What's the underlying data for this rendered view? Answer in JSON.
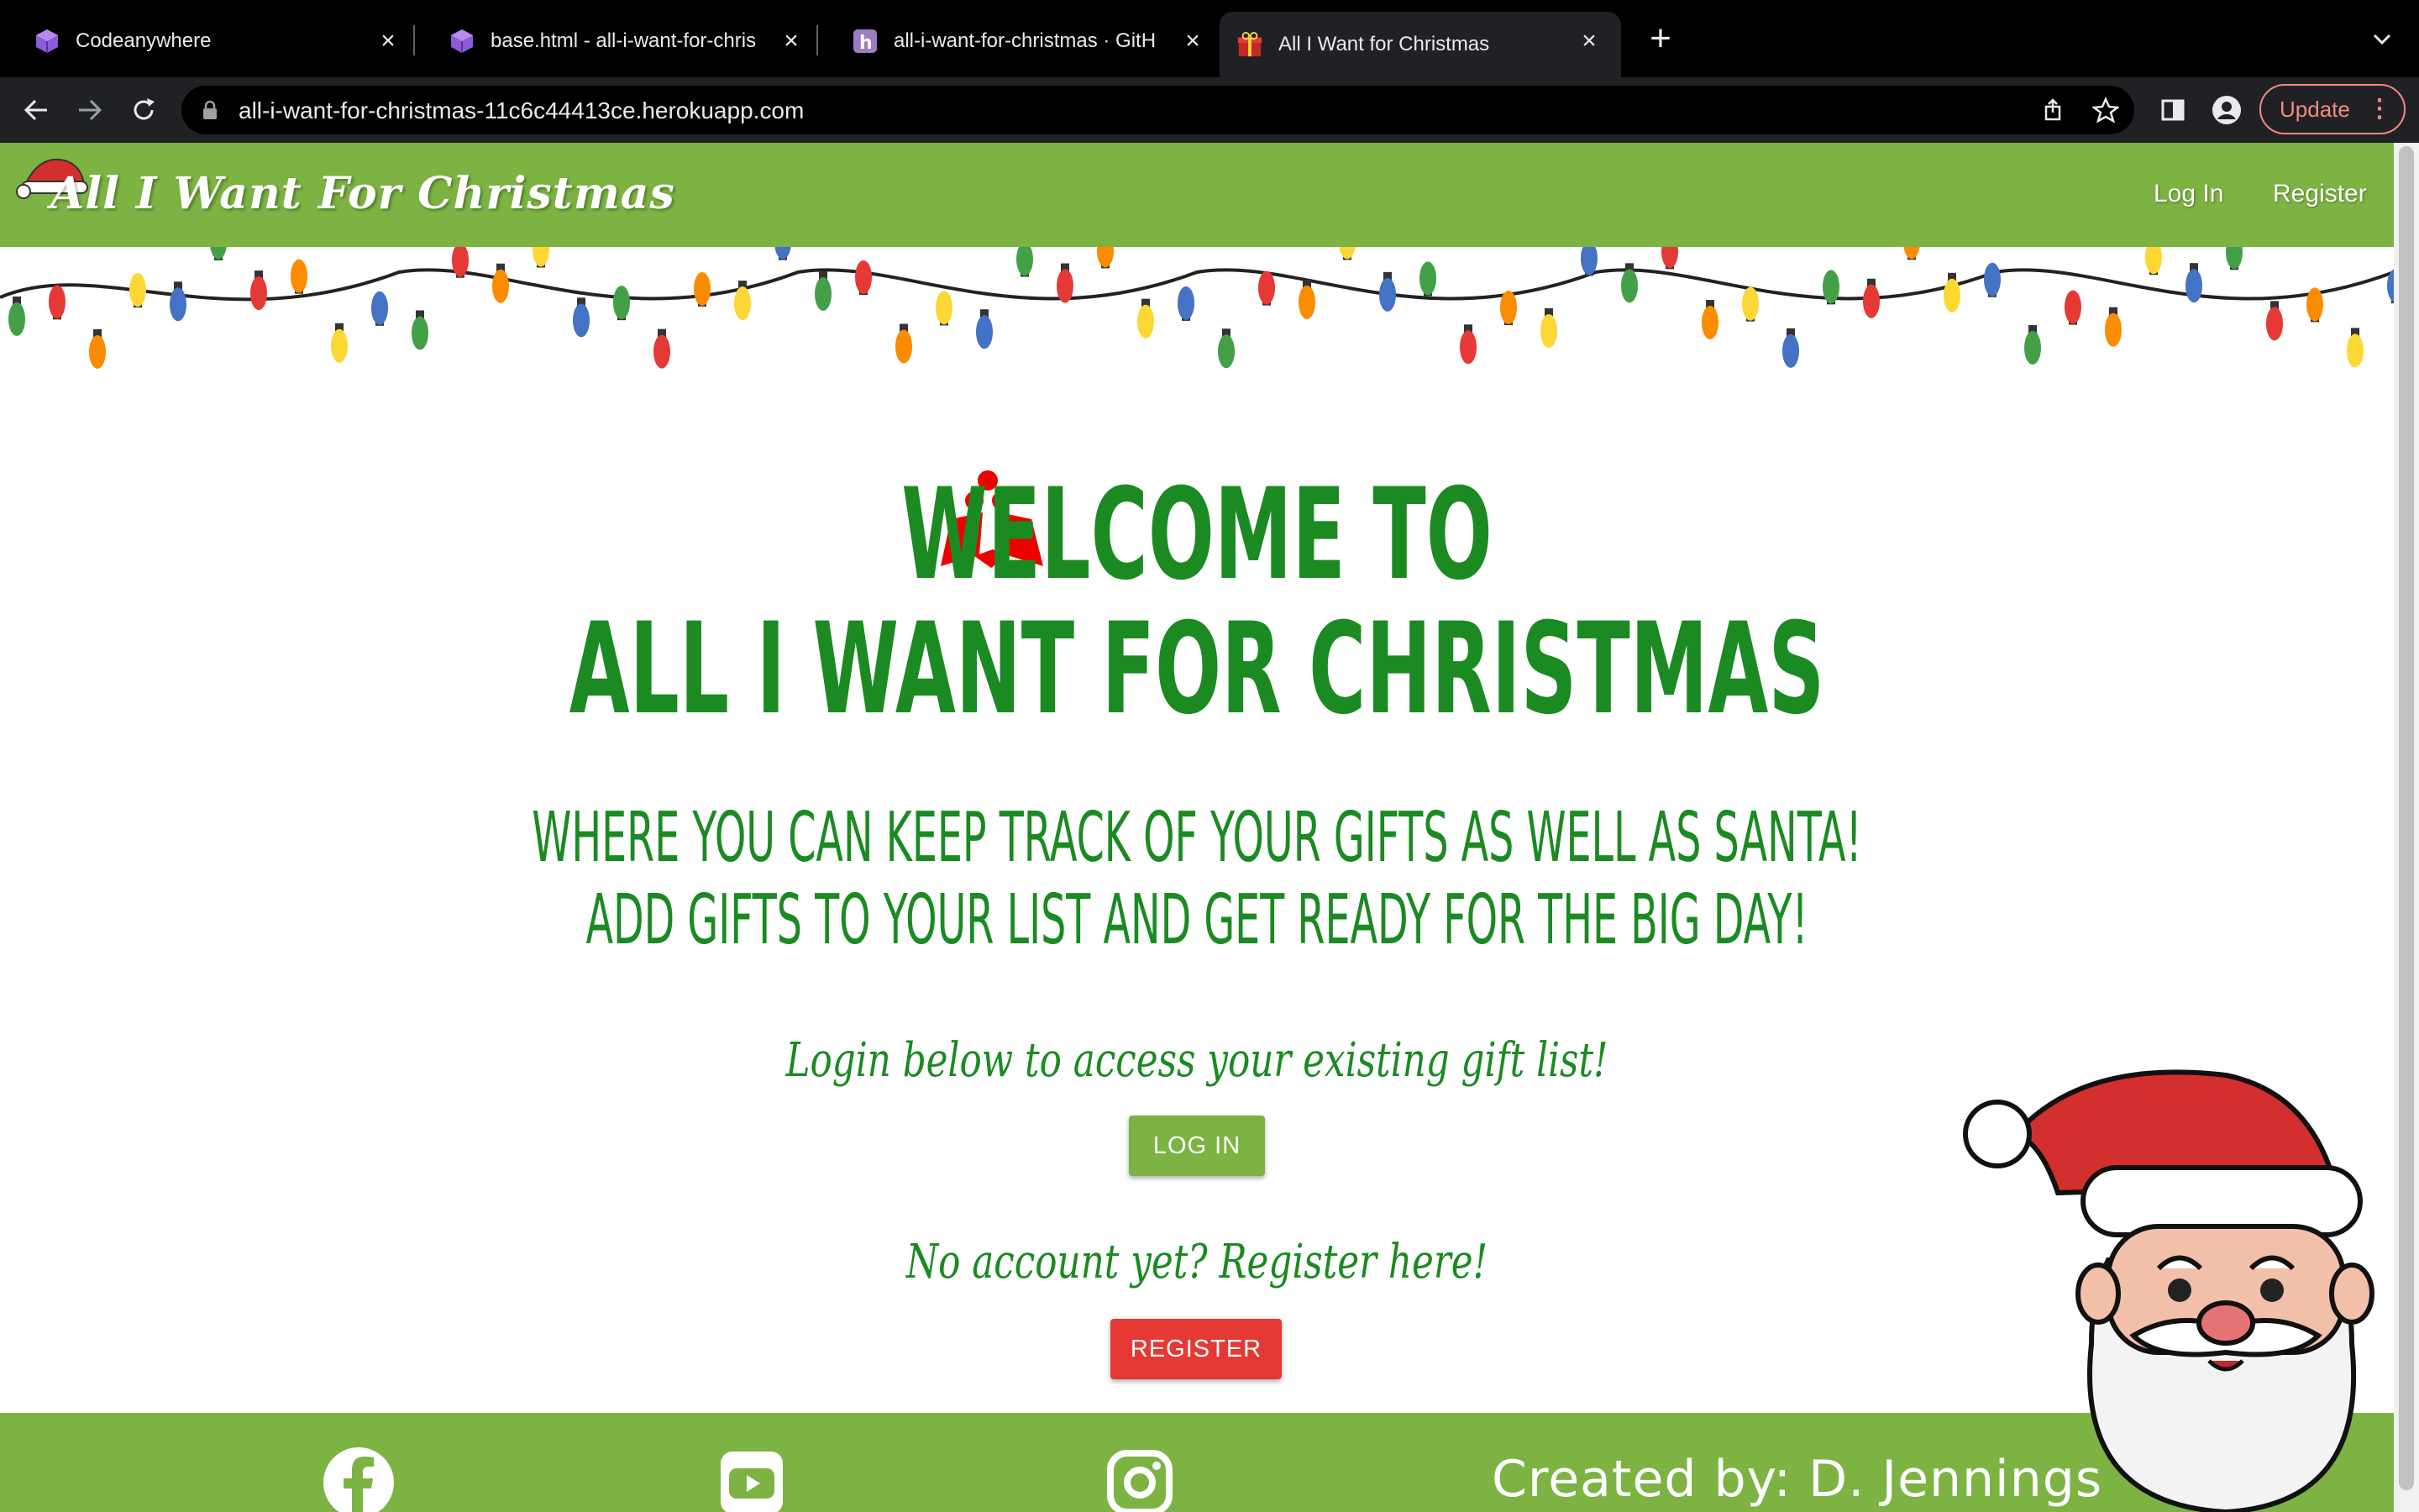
{
  "browser": {
    "tabs": [
      {
        "title": "Codeanywhere",
        "favicon": "codeanywhere-cube-icon",
        "active": false
      },
      {
        "title": "base.html - all-i-want-for-chris",
        "favicon": "codeanywhere-cube-icon",
        "active": false
      },
      {
        "title": "all-i-want-for-christmas · GitH",
        "favicon": "heroku-icon",
        "active": false
      },
      {
        "title": "All I Want for Christmas",
        "favicon": "gift-icon",
        "active": true
      }
    ],
    "url": "all-i-want-for-christmas-11c6c44413ce.herokuapp.com",
    "update_label": "Update"
  },
  "site": {
    "brand": "All I Want For Christmas",
    "nav": {
      "login": "Log In",
      "register": "Register"
    },
    "colors": {
      "primary_green": "#7cb342",
      "text_green": "#1b8a22",
      "register_red": "#e53935"
    }
  },
  "main": {
    "title_line1": "Welcome to",
    "title_line2": "All I Want For Christmas",
    "subtitle_line1": "Where you can keep track of your gifts as well as Santa!",
    "subtitle_line2": "Add gifts to your list and get ready for the big day!",
    "login_prompt": "Login below to access your existing gift list!",
    "login_button": "LOG IN",
    "register_prompt": "No account yet? Register here!",
    "register_button": "REGISTER"
  },
  "footer": {
    "icons": [
      "facebook-icon",
      "youtube-icon",
      "instagram-icon"
    ],
    "credit": "Created by: D. Jennings"
  }
}
